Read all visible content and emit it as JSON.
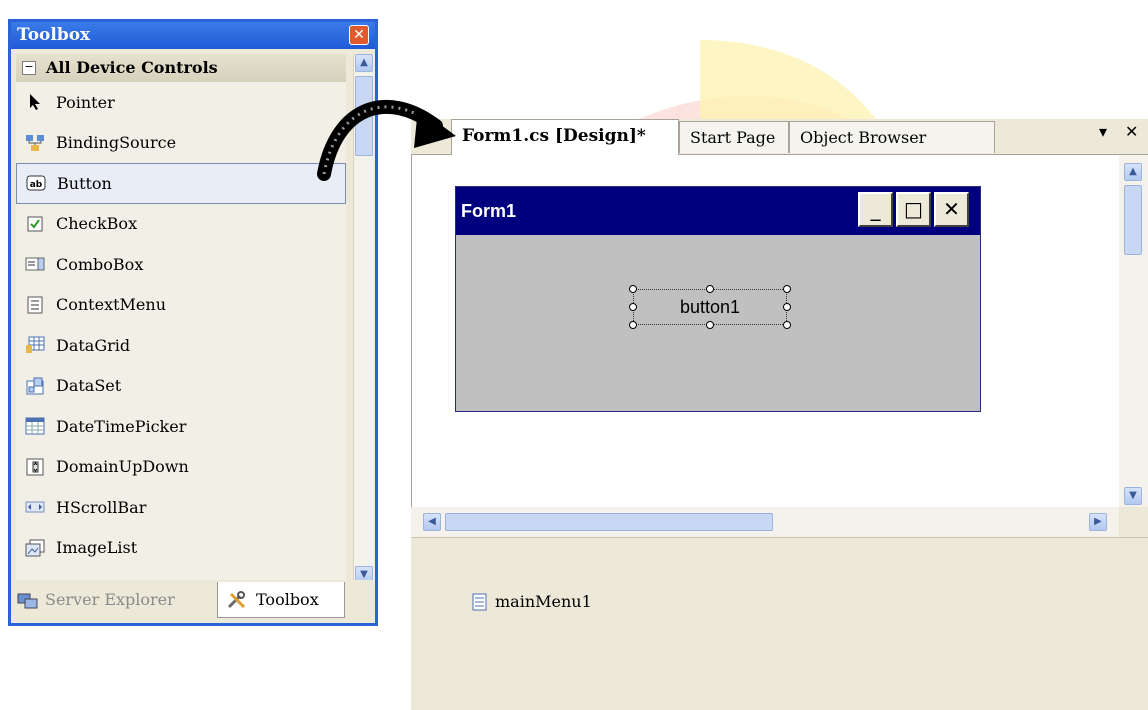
{
  "toolbox": {
    "title": "Toolbox",
    "group_label": "All Device Controls",
    "items": [
      {
        "label": "Pointer",
        "icon": "pointer-icon"
      },
      {
        "label": "BindingSource",
        "icon": "binding-source-icon"
      },
      {
        "label": "Button",
        "icon": "button-icon"
      },
      {
        "label": "CheckBox",
        "icon": "checkbox-icon"
      },
      {
        "label": "ComboBox",
        "icon": "combobox-icon"
      },
      {
        "label": "ContextMenu",
        "icon": "context-menu-icon"
      },
      {
        "label": "DataGrid",
        "icon": "datagrid-icon"
      },
      {
        "label": "DataSet",
        "icon": "dataset-icon"
      },
      {
        "label": "DateTimePicker",
        "icon": "datetimepicker-icon"
      },
      {
        "label": "DomainUpDown",
        "icon": "domainupdown-icon"
      },
      {
        "label": "HScrollBar",
        "icon": "hscrollbar-icon"
      },
      {
        "label": "ImageList",
        "icon": "imagelist-icon"
      }
    ],
    "selected_item": "Button",
    "bottom_tabs": {
      "server_explorer": "Server Explorer",
      "toolbox": "Toolbox"
    }
  },
  "designer": {
    "tabs": [
      {
        "label": "Form1.cs [Design]*",
        "active": true
      },
      {
        "label": "Start Page",
        "active": false
      },
      {
        "label": "Object Browser",
        "active": false
      }
    ],
    "form": {
      "title": "Form1",
      "button_text": "button1"
    },
    "tray_component": "mainMenu1"
  },
  "colors": {
    "titlebar": "#1f5ad7",
    "form_caption": "#00007e",
    "form_body": "#c0c0c0"
  }
}
